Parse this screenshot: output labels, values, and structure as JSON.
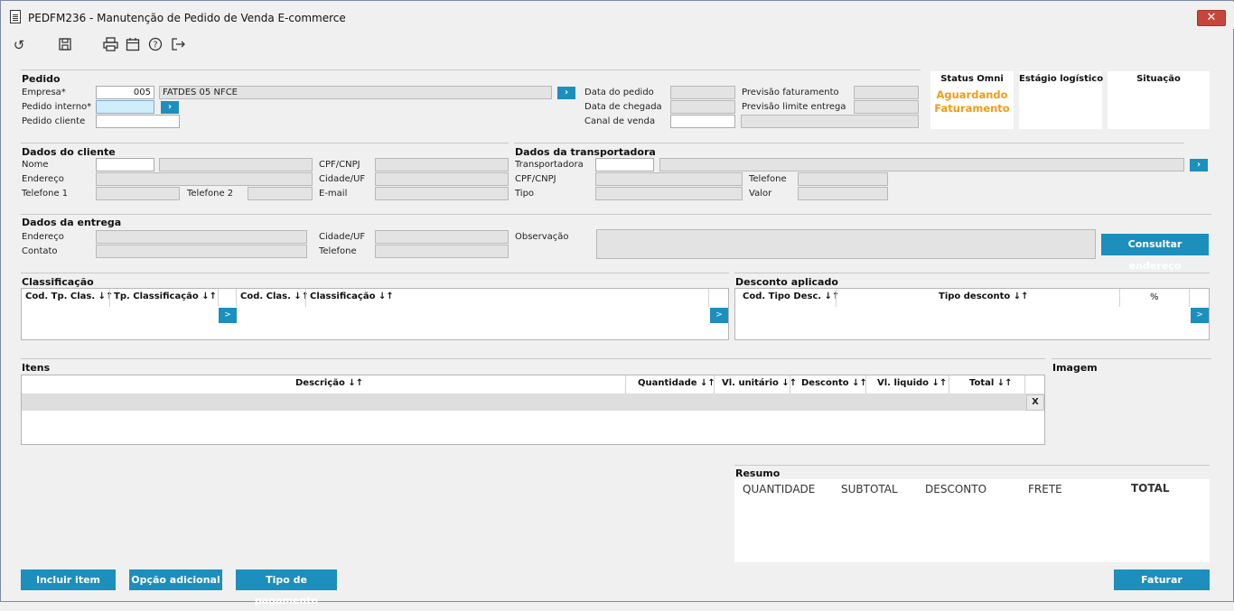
{
  "window": {
    "title": "PEDFM236 - Manutenção de Pedido de Venda E-commerce",
    "close": "✕"
  },
  "toolbar": {
    "icons": [
      "undo-icon",
      "save-icon",
      "print-icon",
      "calendar-icon",
      "help-icon",
      "exit-icon"
    ]
  },
  "pedido": {
    "section": "Pedido",
    "empresa_label": "Empresa*",
    "empresa_code": "005",
    "empresa_name": "FATDES 05 NFCE",
    "pedido_interno_label": "Pedido interno*",
    "pedido_cliente_label": "Pedido cliente",
    "data_pedido_label": "Data do pedido",
    "data_chegada_label": "Data de chegada",
    "canal_venda_label": "Canal de venda",
    "prev_fat_label": "Previsão faturamento",
    "prev_limite_label": "Previsão limite entrega"
  },
  "status": {
    "omni_label": "Status Omni",
    "omni_value_1": "Aguardando",
    "omni_value_2": "Faturamento",
    "estagio_label": "Estágio logístico",
    "situacao_label": "Situação"
  },
  "cliente": {
    "section": "Dados do cliente",
    "nome": "Nome",
    "endereco": "Endereço",
    "telefone1": "Telefone 1",
    "telefone2": "Telefone 2",
    "cpf": "CPF/CNPJ",
    "cidade": "Cidade/UF",
    "email": "E-mail"
  },
  "transportadora": {
    "section": "Dados da transportadora",
    "transportadora": "Transportadora",
    "cpf": "CPF/CNPJ",
    "tipo": "Tipo",
    "telefone": "Telefone",
    "valor": "Valor"
  },
  "entrega": {
    "section": "Dados da entrega",
    "endereco": "Endereço",
    "contato": "Contato",
    "cidade": "Cidade/UF",
    "telefone": "Telefone",
    "observacao": "Observação",
    "consultar": "Consultar endereço"
  },
  "classificacao": {
    "section": "Classificação",
    "cols": [
      "Cod. Tp. Clas. ↓↑",
      "Tp. Classificação ↓↑",
      "Cod. Clas. ↓↑",
      "Classificação ↓↑"
    ],
    "go": ">"
  },
  "desconto": {
    "section": "Desconto aplicado",
    "cols": [
      "Cod. Tipo Desc. ↓↑",
      "Tipo desconto ↓↑",
      "%"
    ],
    "go": ">"
  },
  "itens": {
    "section": "Itens",
    "cols": [
      "Descrição ↓↑",
      "Quantidade ↓↑",
      "Vl. unitário ↓↑",
      "Desconto ↓↑",
      "Vl. liquido ↓↑",
      "Total ↓↑"
    ],
    "remove": "X"
  },
  "imagem": {
    "section": "Imagem"
  },
  "resumo": {
    "section": "Resumo",
    "quantidade": "QUANTIDADE",
    "subtotal": "SUBTOTAL",
    "desconto": "DESCONTO",
    "frete": "FRETE",
    "total": "TOTAL"
  },
  "buttons": {
    "incluir": "Incluir item",
    "opcao": "Opção adicional",
    "pagamento": "Tipo de pagamento",
    "faturar": "Faturar"
  }
}
